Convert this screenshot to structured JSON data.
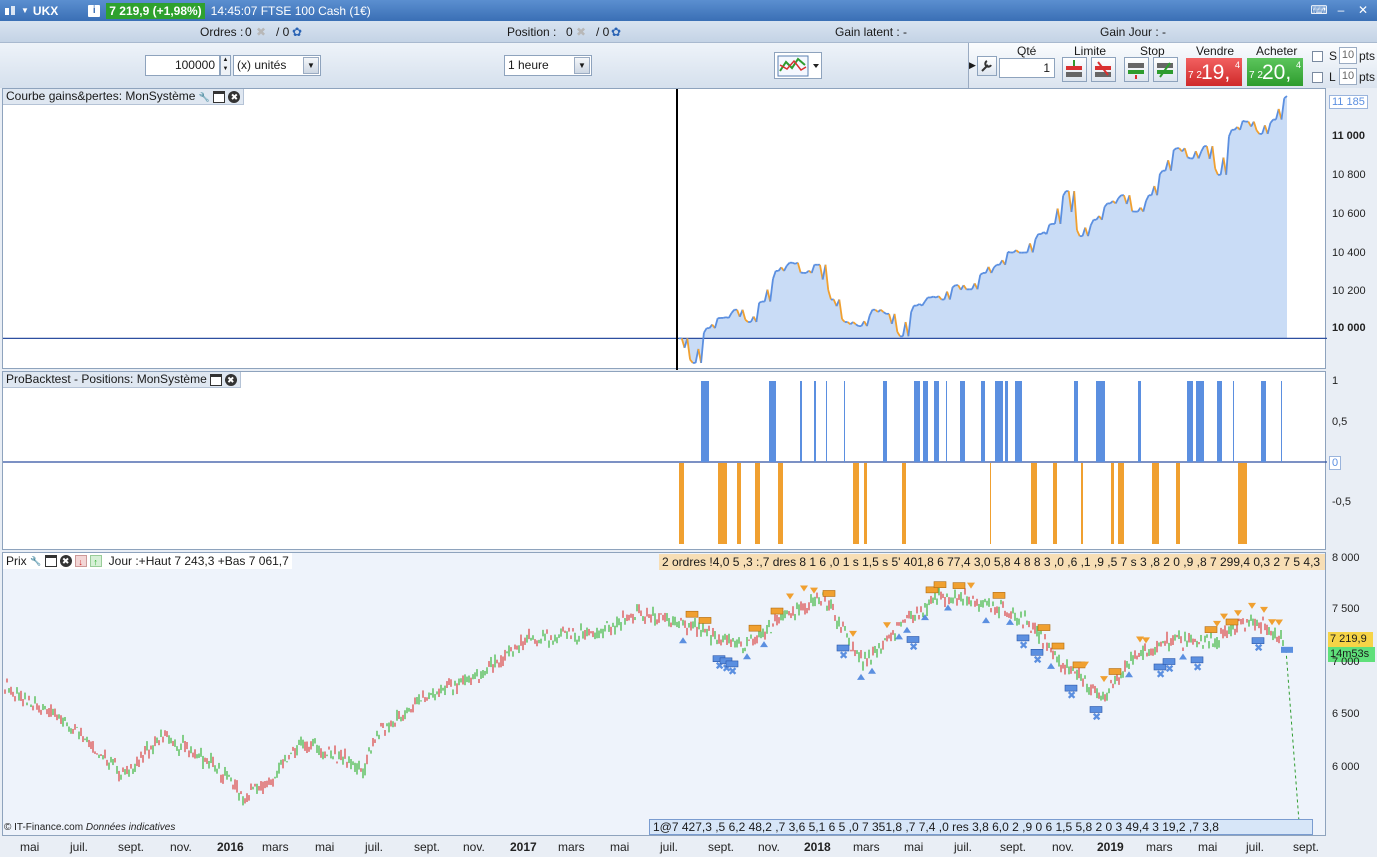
{
  "title_bar": {
    "symbol": "UKX",
    "price_badge": "7 219,9 (+1,98%)",
    "description": "14:45:07 FTSE 100 Cash (1€)",
    "info_icon": "i"
  },
  "info_bar": {
    "orders_label": "Ordres :",
    "orders_pending": "0",
    "orders_total": "/ 0",
    "position_label": "Position :",
    "position_pending": "0",
    "position_total": "/ 0",
    "unrealized_label": "Gain latent : -",
    "daily_gain_label": "Gain Jour : -"
  },
  "toolbar": {
    "quantity_value": "100000",
    "unit_select": "(x) unités",
    "timeframe_select": "1 heure"
  },
  "trade_panel": {
    "qty_label": "Qté",
    "qty_value": "1",
    "limit_label": "Limite",
    "stop_label": "Stop",
    "sell_label": "Vendre",
    "buy_label": "Acheter",
    "sell_prefix": "7 2",
    "sell_main": "19,",
    "sell_sup": "4",
    "buy_prefix": "7 2",
    "buy_main": "20,",
    "buy_sup": "4",
    "s_label": "S",
    "l_label": "L",
    "s_points": "10",
    "l_points": "10",
    "pts_label": "pts"
  },
  "panels": {
    "equity": {
      "title": "Courbe gains&pertes: MonSystème",
      "axis_labels": [
        "11 185",
        "11 000",
        "10 800",
        "10 600",
        "10 400",
        "10 200",
        "10 000"
      ]
    },
    "positions": {
      "title": "ProBacktest - Positions: MonSystème",
      "axis_labels": [
        "1",
        "0,5",
        "0",
        "-0,5"
      ]
    },
    "price": {
      "title": "Prix",
      "daily_info": "Jour :+Haut 7 243,3 +Bas 7 061,7",
      "orders_strip": "2 ordres !4,0 5 ,3 :,7 dres 8 1 6 ,0 1 s 1,5 s 5' 401,8 6 77,4 3,0 5,8 4 8 8 3 ,0 ,6 ,1 ,9 ,5 7 s 3 ,8 2 0 ,9 ,8 7 299,4 0,3 2 7 5 4,3",
      "bottom_strip": "1@7 427,3 ,5 6,2 48,2 ,7 3,6 5,1 6 5 ,0 7 351,8 ,7 7,4 ,0 res 3,8 6,0 2 ,9 0 6 1,5 5,8 2 0 3 49,4 3 19,2 ,7 3,8",
      "axis_labels": [
        "8 000",
        "7 500",
        "7 000",
        "6 500",
        "6 000"
      ],
      "last_price": "7 219,9",
      "countdown": "14m53s"
    }
  },
  "x_axis_labels": [
    "mai",
    "juil.",
    "sept.",
    "nov.",
    "2016",
    "mars",
    "mai",
    "juil.",
    "sept.",
    "nov.",
    "2017",
    "mars",
    "mai",
    "juil.",
    "sept.",
    "nov.",
    "2018",
    "mars",
    "mai",
    "juil.",
    "sept.",
    "nov.",
    "2019",
    "mars",
    "mai",
    "juil.",
    "sept."
  ],
  "copyright": "© IT-Finance.com",
  "copyright_note": "Données indicatives",
  "colors": {
    "long": "#5b8fe0",
    "short": "#f0a030",
    "equity_fill": "#c9dcf6",
    "candle_up": "#3cb53c",
    "candle_down": "#d94040"
  },
  "chart_data": [
    {
      "type": "area",
      "title": "Courbe gains&pertes: MonSystème",
      "series": [
        {
          "values": [
            10000,
            9880,
            10050,
            10100,
            10140,
            10080,
            10180,
            10330,
            10370,
            10320,
            10360,
            10190,
            10080,
            10060,
            10140,
            10120,
            10010,
            10160,
            10200,
            10190,
            10260,
            10240,
            10320,
            10360,
            10420,
            10420,
            10510,
            10560,
            10720,
            10500,
            10580,
            10660,
            10700,
            10620,
            10700,
            10820,
            10930,
            10880,
            10940,
            10800,
            11020,
            11060,
            11000,
            11070,
            11185
          ]
        }
      ],
      "ylim": [
        9860,
        11200
      ]
    },
    {
      "type": "bar",
      "title": "ProBacktest - Positions: MonSystème",
      "ylim": [
        -1,
        1
      ]
    },
    {
      "type": "line",
      "title": "Prix",
      "ylim": [
        5600,
        8050
      ],
      "last": 7219.9,
      "day_high": 7243.3,
      "day_low": 7061.7
    }
  ]
}
